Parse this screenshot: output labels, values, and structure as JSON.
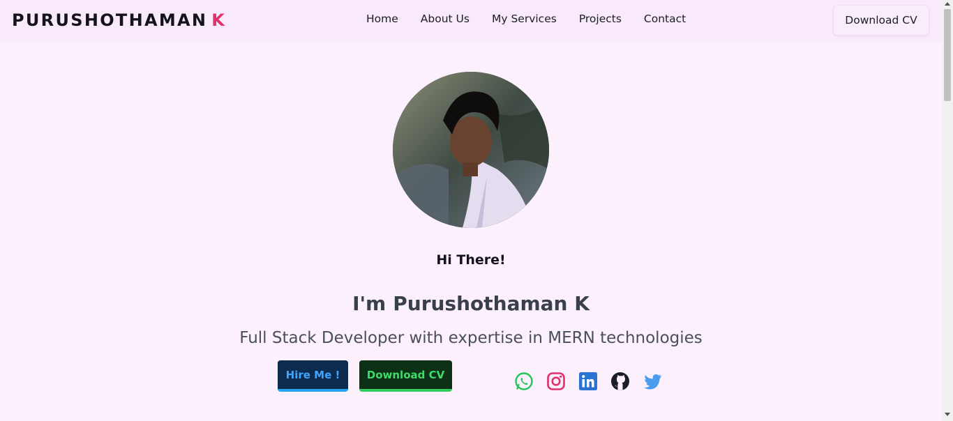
{
  "brand": {
    "name": "PURUSHOTHAMAN",
    "initial": "K",
    "accent_color": "#e0306e"
  },
  "nav": {
    "items": [
      "Home",
      "About Us",
      "My Services",
      "Projects",
      "Contact"
    ],
    "cta_label": "Download CV"
  },
  "hero": {
    "greeting": "Hi There!",
    "im": "I'm",
    "name": "Purushothaman K",
    "tagline": "Full Stack Developer with expertise in MERN technologies",
    "hire_label": "Hire Me !",
    "download_label": "Download CV"
  },
  "socials": [
    {
      "icon": "whatsapp-icon",
      "color": "#25c45a"
    },
    {
      "icon": "instagram-icon",
      "color": "#e1306c"
    },
    {
      "icon": "linkedin-icon",
      "color": "#2a73d2"
    },
    {
      "icon": "github-icon",
      "color": "#1b1f24"
    },
    {
      "icon": "twitter-icon",
      "color": "#4a9dee"
    }
  ]
}
